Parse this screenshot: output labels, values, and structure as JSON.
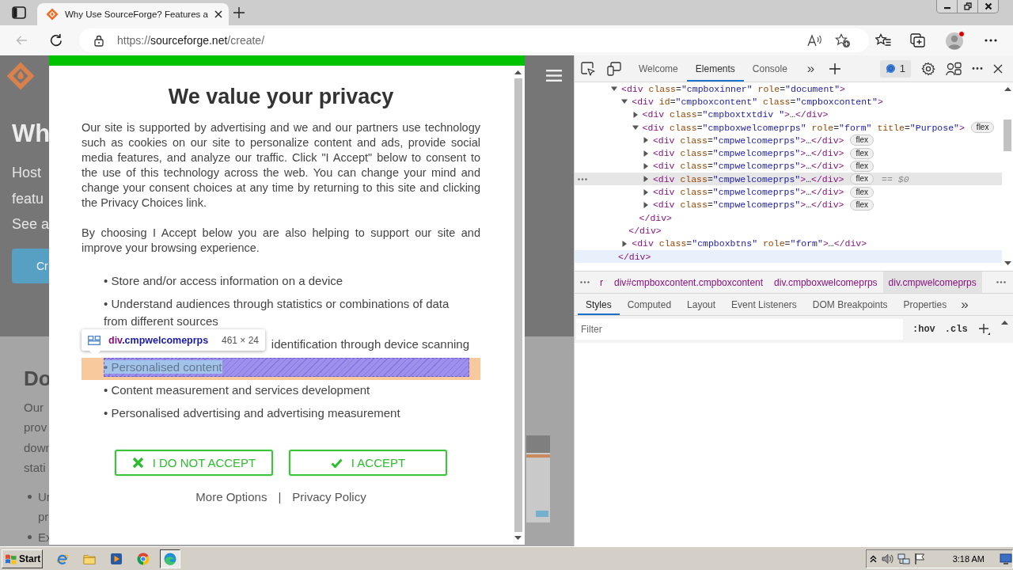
{
  "browser": {
    "tabs": [
      {
        "title": "Why Use SourceForge? Features a",
        "selected": true
      }
    ],
    "address": {
      "scheme": "https://",
      "host": "sourceforge.net",
      "path": "/create/"
    },
    "back_disabled": true
  },
  "background_page": {
    "heading": "Wh",
    "intro_lines": [
      "Host",
      "featu",
      "See a"
    ],
    "button": "Cr",
    "section_heading": "Do",
    "paragraph_lines": [
      "Our",
      "prov",
      "down",
      "stati"
    ],
    "bullets": [
      {
        "lines": [
          "Ur",
          "pr"
        ]
      },
      {
        "lines": [
          "Ex"
        ]
      }
    ]
  },
  "consent_dialog": {
    "title": "We value your privacy",
    "paragraphs": [
      "Our site is supported by advertising and we and our partners use technology such as cookies on our site to personalize content and ads, provide social media features, and analyze our traffic. Click \"I Accept\" below to consent to the use of this technology across the web. You can change your mind and change your consent choices at any time by returning to this site and clicking the Privacy Choices link.",
      "By choosing I Accept below you are also helping to support our site and improve your browsing experience."
    ],
    "purposes": [
      {
        "text": "• Store and/or access information on a device",
        "highlighted": false,
        "covered": false
      },
      {
        "text": "• Understand audiences through statistics or combinations of data from different sources",
        "highlighted": false,
        "covered": false
      },
      {
        "text": "identification through device scanning",
        "highlighted": false,
        "covered": true
      },
      {
        "text": "• Personalised content",
        "highlighted": true,
        "covered": false
      },
      {
        "text": "• Content measurement and services development",
        "highlighted": false,
        "covered": false
      },
      {
        "text": "• Personalised advertising and advertising measurement",
        "highlighted": false,
        "covered": false
      }
    ],
    "buttons": [
      {
        "label": "I DO NOT ACCEPT",
        "kind": "reject"
      },
      {
        "label": "I ACCEPT",
        "kind": "accept"
      }
    ],
    "links": [
      "More Options",
      "Privacy Policy"
    ],
    "separator": "|"
  },
  "inspect_tooltip": {
    "tag": "div",
    "classes": ".cmpwelcomeprps",
    "size": "461 × 24"
  },
  "devtools": {
    "tabs": [
      {
        "label": "Welcome",
        "selected": false
      },
      {
        "label": "Elements",
        "selected": true
      },
      {
        "label": "Console",
        "selected": false
      }
    ],
    "more_tabs": "»",
    "issues_count": "1",
    "dom_tree": [
      {
        "text": "<div class=\"cmpboxinner\" role=\"document\">",
        "expanded": true,
        "selected": false,
        "children": [
          {
            "text": "<div id=\"cmpboxcontent\" class=\"cmpboxcontent\">",
            "expanded": true,
            "selected": false,
            "children": [
              {
                "text": "<div class=\"cmpboxtxtdiv \">…</div>",
                "expanded": false,
                "selected": false
              },
              {
                "text": "<div class=\"cmpboxwelcomeprps\" role=\"form\" title=\"Purpose\">",
                "badge": "flex",
                "expanded": true,
                "selected": false,
                "children": [
                  {
                    "text": "<div class=\"cmpwelcomeprps\">…</div>",
                    "badge": "flex",
                    "expanded": false,
                    "selected": false
                  },
                  {
                    "text": "<div class=\"cmpwelcomeprps\">…</div>",
                    "badge": "flex",
                    "expanded": false,
                    "selected": false
                  },
                  {
                    "text": "<div class=\"cmpwelcomeprps\">…</div>",
                    "badge": "flex",
                    "expanded": false,
                    "selected": false
                  },
                  {
                    "text": "<div class=\"cmpwelcomeprps\">…</div>",
                    "badge": "flex",
                    "note": "== $0",
                    "expanded": false,
                    "selected": true
                  },
                  {
                    "text": "<div class=\"cmpwelcomeprps\">…</div>",
                    "badge": "flex",
                    "expanded": false,
                    "selected": false
                  },
                  {
                    "text": "<div class=\"cmpwelcomeprps\">…</div>",
                    "badge": "flex",
                    "expanded": false,
                    "selected": false
                  }
                ],
                "close": {
                  "text": "</div>",
                  "hovered": false
                }
              }
            ],
            "close": {
              "text": "</div>",
              "hovered": false
            }
          },
          {
            "text": "<div class=\"cmpboxbtns\" role=\"form\">…</div>",
            "expanded": false,
            "selected": false
          }
        ],
        "close": {
          "text": "</div>",
          "hovered": true
        }
      }
    ],
    "breadcrumbs": [
      {
        "label": "r",
        "selected": false
      },
      {
        "label": "div#cmpboxcontent.cmpboxcontent",
        "selected": false
      },
      {
        "label": "div.cmpboxwelcomeprps",
        "selected": false
      },
      {
        "label": "div.cmpwelcomeprps",
        "selected": true
      }
    ],
    "panel_tabs": [
      {
        "label": "Styles",
        "selected": true
      },
      {
        "label": "Computed",
        "selected": false
      },
      {
        "label": "Layout",
        "selected": false
      },
      {
        "label": "Event Listeners",
        "selected": false
      },
      {
        "label": "DOM Breakpoints",
        "selected": false
      },
      {
        "label": "Properties",
        "selected": false
      }
    ],
    "panel_more": "»",
    "filter": {
      "placeholder": "Filter"
    },
    "filter_buttons": [
      ":hov",
      ".cls"
    ]
  },
  "taskbar": {
    "start": "Start",
    "apps": [
      {
        "kind": "ie",
        "selected": false
      },
      {
        "kind": "folder",
        "selected": false
      },
      {
        "kind": "media",
        "selected": false
      },
      {
        "kind": "chrome",
        "selected": false
      },
      {
        "kind": "edge",
        "selected": true
      }
    ],
    "tray": [
      {
        "kind": "chevron"
      },
      {
        "kind": "speaker"
      },
      {
        "kind": "network"
      },
      {
        "kind": "flag"
      }
    ],
    "clock": "3:18 AM"
  }
}
